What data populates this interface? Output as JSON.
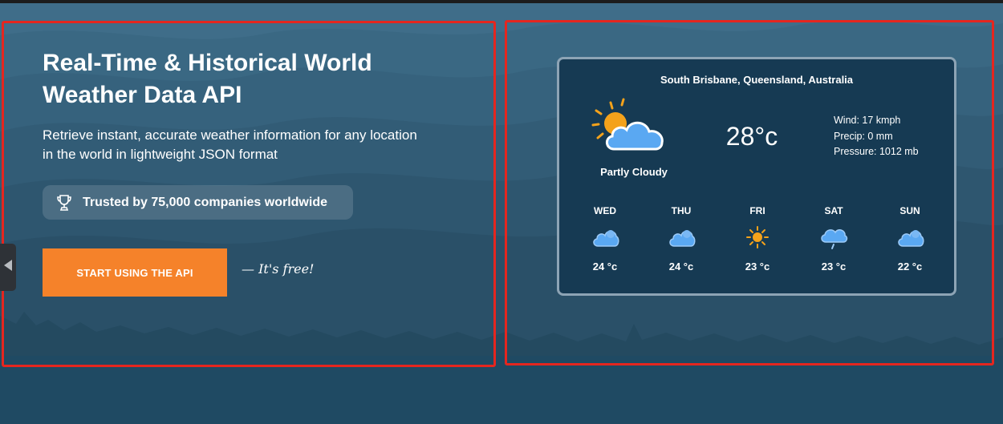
{
  "hero": {
    "title": "Real-Time & Historical World Weather Data API",
    "subtitle": "Retrieve instant, accurate weather information for any location in the world in lightweight JSON format",
    "trust_text": "Trusted by 75,000 companies worldwide",
    "cta_label": "START USING THE API",
    "free_note": "— It's free!"
  },
  "weather": {
    "location": "South Brisbane, Queensland, Australia",
    "temperature": "28°c",
    "condition": "Partly Cloudy",
    "wind": "Wind: 17 kmph",
    "precip": "Precip: 0 mm",
    "pressure": "Pressure: 1012 mb",
    "forecast": [
      {
        "day": "WED",
        "temp": "24 °c",
        "icon": "cloudy-icon"
      },
      {
        "day": "THU",
        "temp": "24 °c",
        "icon": "cloudy-icon"
      },
      {
        "day": "FRI",
        "temp": "23 °c",
        "icon": "sun-icon"
      },
      {
        "day": "SAT",
        "temp": "23 °c",
        "icon": "rain-cloud-icon"
      },
      {
        "day": "SUN",
        "temp": "22 °c",
        "icon": "cloudy-icon"
      }
    ]
  },
  "colors": {
    "cta": "#f5822a",
    "card_bg": "#163a53",
    "highlight_border": "#e5261f"
  }
}
